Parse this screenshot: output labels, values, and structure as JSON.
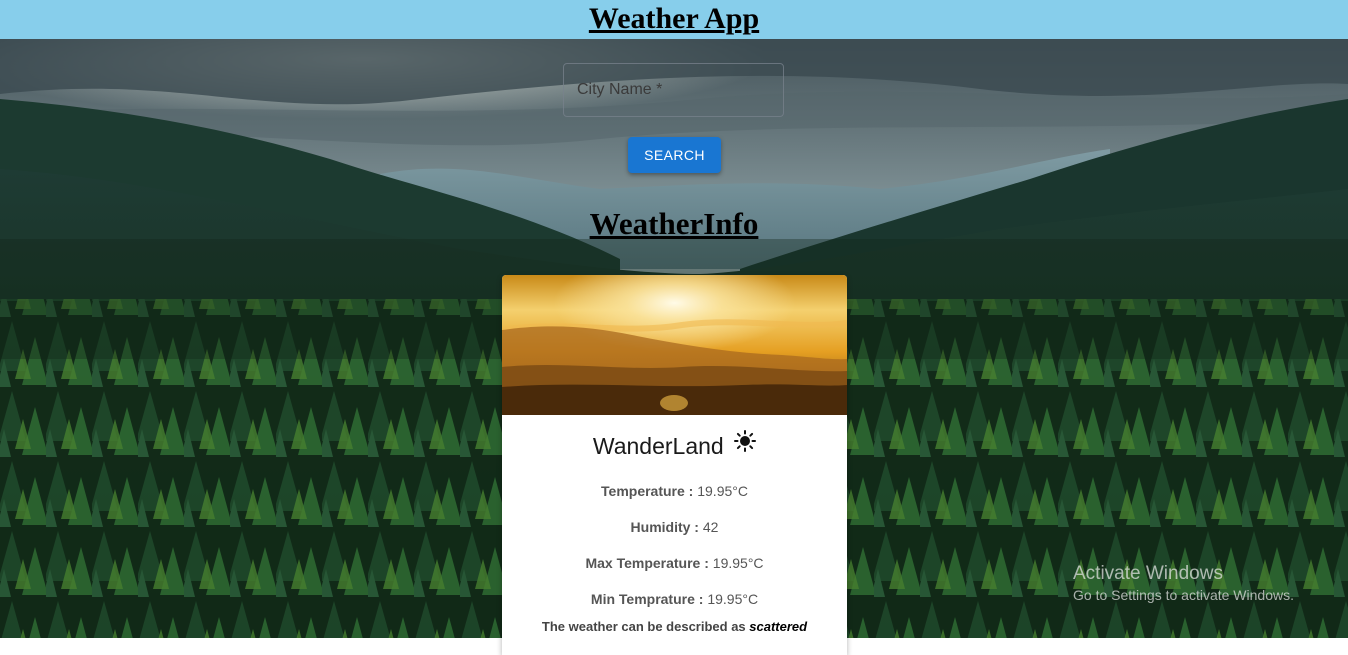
{
  "header": {
    "title": "Weather App"
  },
  "search": {
    "placeholder": "City Name *",
    "value": "",
    "button_label": "SEARCH"
  },
  "info": {
    "heading": "WeatherInfo",
    "city": "WanderLand",
    "weather_icon": "sun-icon",
    "rows": [
      {
        "label": "Temperature :",
        "value": "19.95°C"
      },
      {
        "label": "Humidity :",
        "value": "42"
      },
      {
        "label": "Max Temperature :",
        "value": "19.95°C"
      },
      {
        "label": "Min Temprature :",
        "value": "19.95°C"
      }
    ],
    "description_prefix": "The weather can be described as",
    "description": "scattered"
  },
  "watermark": {
    "line1": "Activate Windows",
    "line2": "Go to Settings to activate Windows."
  },
  "colors": {
    "header_bg": "#87ceeb",
    "button_bg": "#1976d2",
    "card_bg": "#ffffff"
  }
}
